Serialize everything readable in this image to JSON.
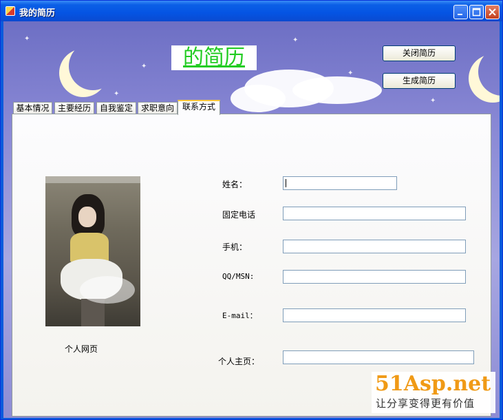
{
  "window": {
    "title": "我的简历"
  },
  "header": {
    "heading": "的简历"
  },
  "buttons": {
    "close_resume": "关闭简历",
    "generate_resume": "生成简历"
  },
  "tabs": [
    {
      "label": "基本情况"
    },
    {
      "label": "主要经历"
    },
    {
      "label": "自我鉴定"
    },
    {
      "label": "求职意向"
    },
    {
      "label": "联系方式",
      "active": true
    }
  ],
  "photo": {
    "caption": "个人网页"
  },
  "form": {
    "name_label": "姓名：",
    "phone_label": "固定电话",
    "mobile_label": "手机：",
    "qq_label": "QQ/MSN:",
    "email_label": "E-mail：",
    "homepage_label": "个人主页：",
    "name_value": "",
    "phone_value": "",
    "mobile_value": "",
    "qq_value": "",
    "email_value": "",
    "homepage_value": ""
  },
  "watermark": {
    "logo": "51Asp.net",
    "tagline": "让分享变得更有价值"
  },
  "colors": {
    "heading": "#22cc22",
    "titlebar": "#0554e3",
    "background": "#8887d4",
    "active_tab": "#ffc83c"
  },
  "icons": {
    "minimize": "minimize-icon",
    "maximize": "maximize-icon",
    "close": "close-icon"
  }
}
